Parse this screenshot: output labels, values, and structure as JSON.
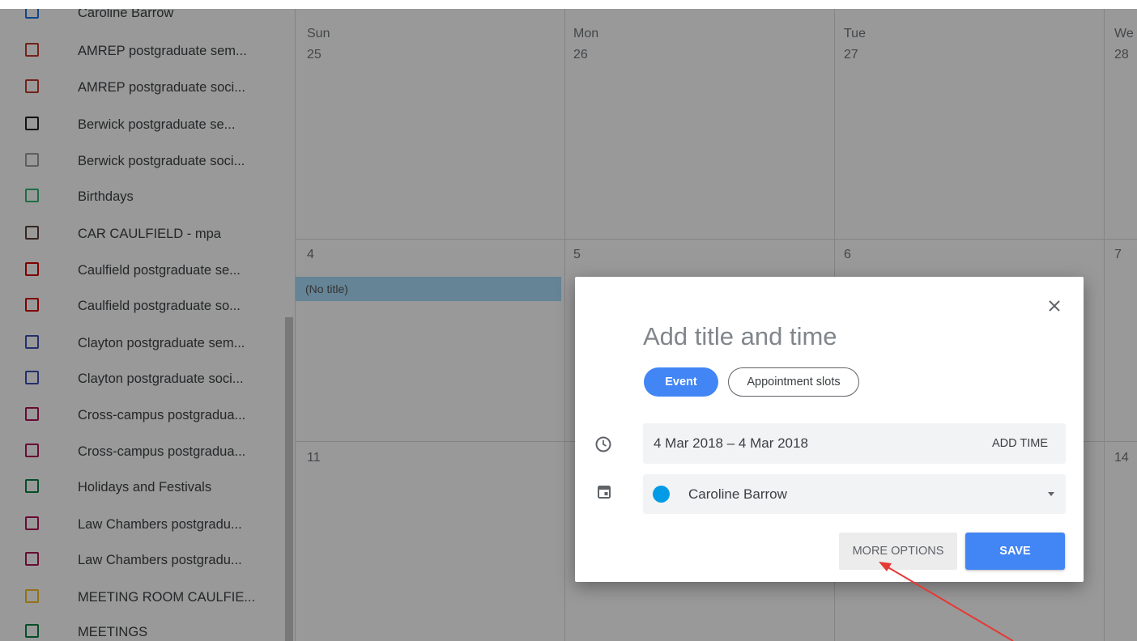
{
  "sidebar": {
    "calendars": [
      {
        "label": "Caroline Barrow",
        "color": "#1a73e8"
      },
      {
        "label": "AMREP postgraduate sem...",
        "color": "#c0392b"
      },
      {
        "label": "AMREP postgraduate soci...",
        "color": "#c0392b"
      },
      {
        "label": "Berwick postgraduate se...",
        "color": "#202124"
      },
      {
        "label": "Berwick postgraduate soci...",
        "color": "#9e9e9e"
      },
      {
        "label": "Birthdays",
        "color": "#33b679"
      },
      {
        "label": "CAR CAULFIELD - mpa",
        "color": "#5d4037"
      },
      {
        "label": "Caulfield postgraduate se...",
        "color": "#d50000"
      },
      {
        "label": "Caulfield postgraduate so...",
        "color": "#d50000"
      },
      {
        "label": "Clayton postgraduate sem...",
        "color": "#3f51b5"
      },
      {
        "label": "Clayton postgraduate soci...",
        "color": "#3f51b5"
      },
      {
        "label": "Cross-campus postgradua...",
        "color": "#ad1457"
      },
      {
        "label": "Cross-campus postgradua...",
        "color": "#ad1457"
      },
      {
        "label": "Holidays and Festivals",
        "color": "#0b8043"
      },
      {
        "label": "Law Chambers postgradu...",
        "color": "#ad1457"
      },
      {
        "label": "Law Chambers postgradu...",
        "color": "#ad1457"
      },
      {
        "label": "MEETING ROOM CAULFIE...",
        "color": "#f6bf26"
      },
      {
        "label": "MEETINGS",
        "color": "#0b8043"
      }
    ]
  },
  "grid": {
    "weekdays": [
      "Sun",
      "Mon",
      "Tue",
      "We"
    ],
    "week1": [
      "25",
      "26",
      "27",
      "28"
    ],
    "week2": [
      "4",
      "5",
      "6",
      "7"
    ],
    "week3": [
      "11",
      "14"
    ],
    "event_chip": "(No title)"
  },
  "dialog": {
    "title_placeholder": "Add title and time",
    "chip_event": "Event",
    "chip_appointment": "Appointment slots",
    "date_range": "4 Mar 2018  –  4 Mar 2018",
    "add_time": "ADD TIME",
    "calendar_name": "Caroline Barrow",
    "calendar_color": "#039be5",
    "more_options": "MORE OPTIONS",
    "save": "SAVE"
  },
  "colors": {
    "accent": "#4285f4",
    "annotation_arrow": "#e53935"
  }
}
